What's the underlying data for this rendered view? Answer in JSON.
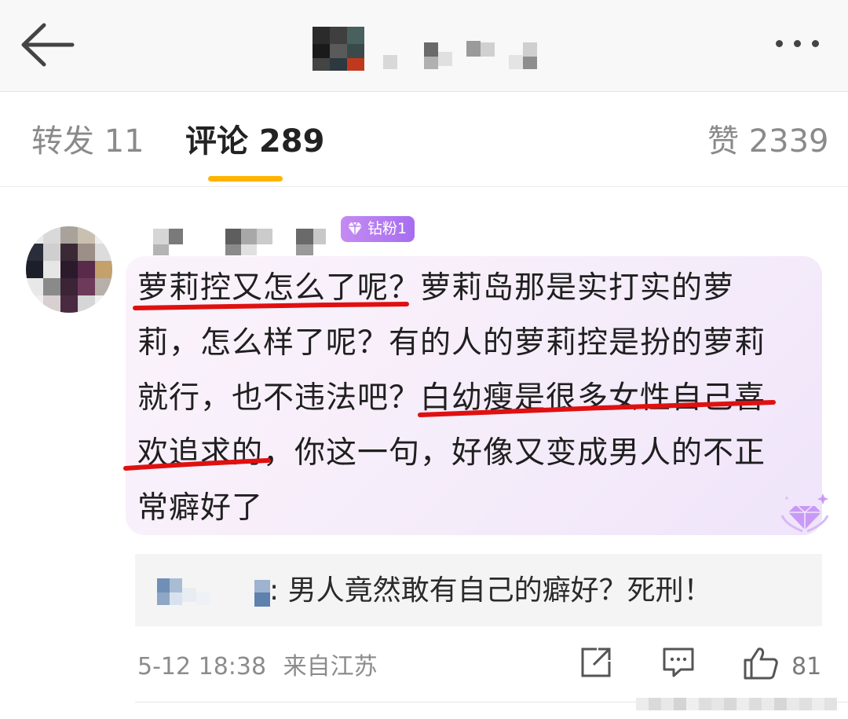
{
  "header": {
    "title": "",
    "back_icon": "back-arrow-icon",
    "more_icon": "more-dots-icon"
  },
  "tabs": [
    {
      "label": "转发 11",
      "active": false
    },
    {
      "label": "评论 289",
      "active": true
    },
    {
      "label": "赞 2339",
      "active": false
    }
  ],
  "colors": {
    "accent": "#ffb400",
    "badge": "#b57cf1",
    "bubble": "#f6edf9",
    "underline_annotation": "#e01010"
  },
  "comment": {
    "username": "",
    "badge_label": "钻粉1",
    "lines": [
      "萝莉控又怎么了呢？萝莉岛那是实打实的萝",
      "莉，怎么样了呢？有的人的萝莉控是扮的萝莉",
      "就行，也不违法吧？白幼瘦是很多女性自己喜",
      "欢追求的，你这一句，好像又变成男人的不正",
      "常癖好了"
    ],
    "reply": {
      "user": "",
      "text": ": 男人竟然敢有自己的癖好？死刑！"
    },
    "time": "5-12 18:38",
    "location": "来自江苏",
    "like_count": "81"
  }
}
